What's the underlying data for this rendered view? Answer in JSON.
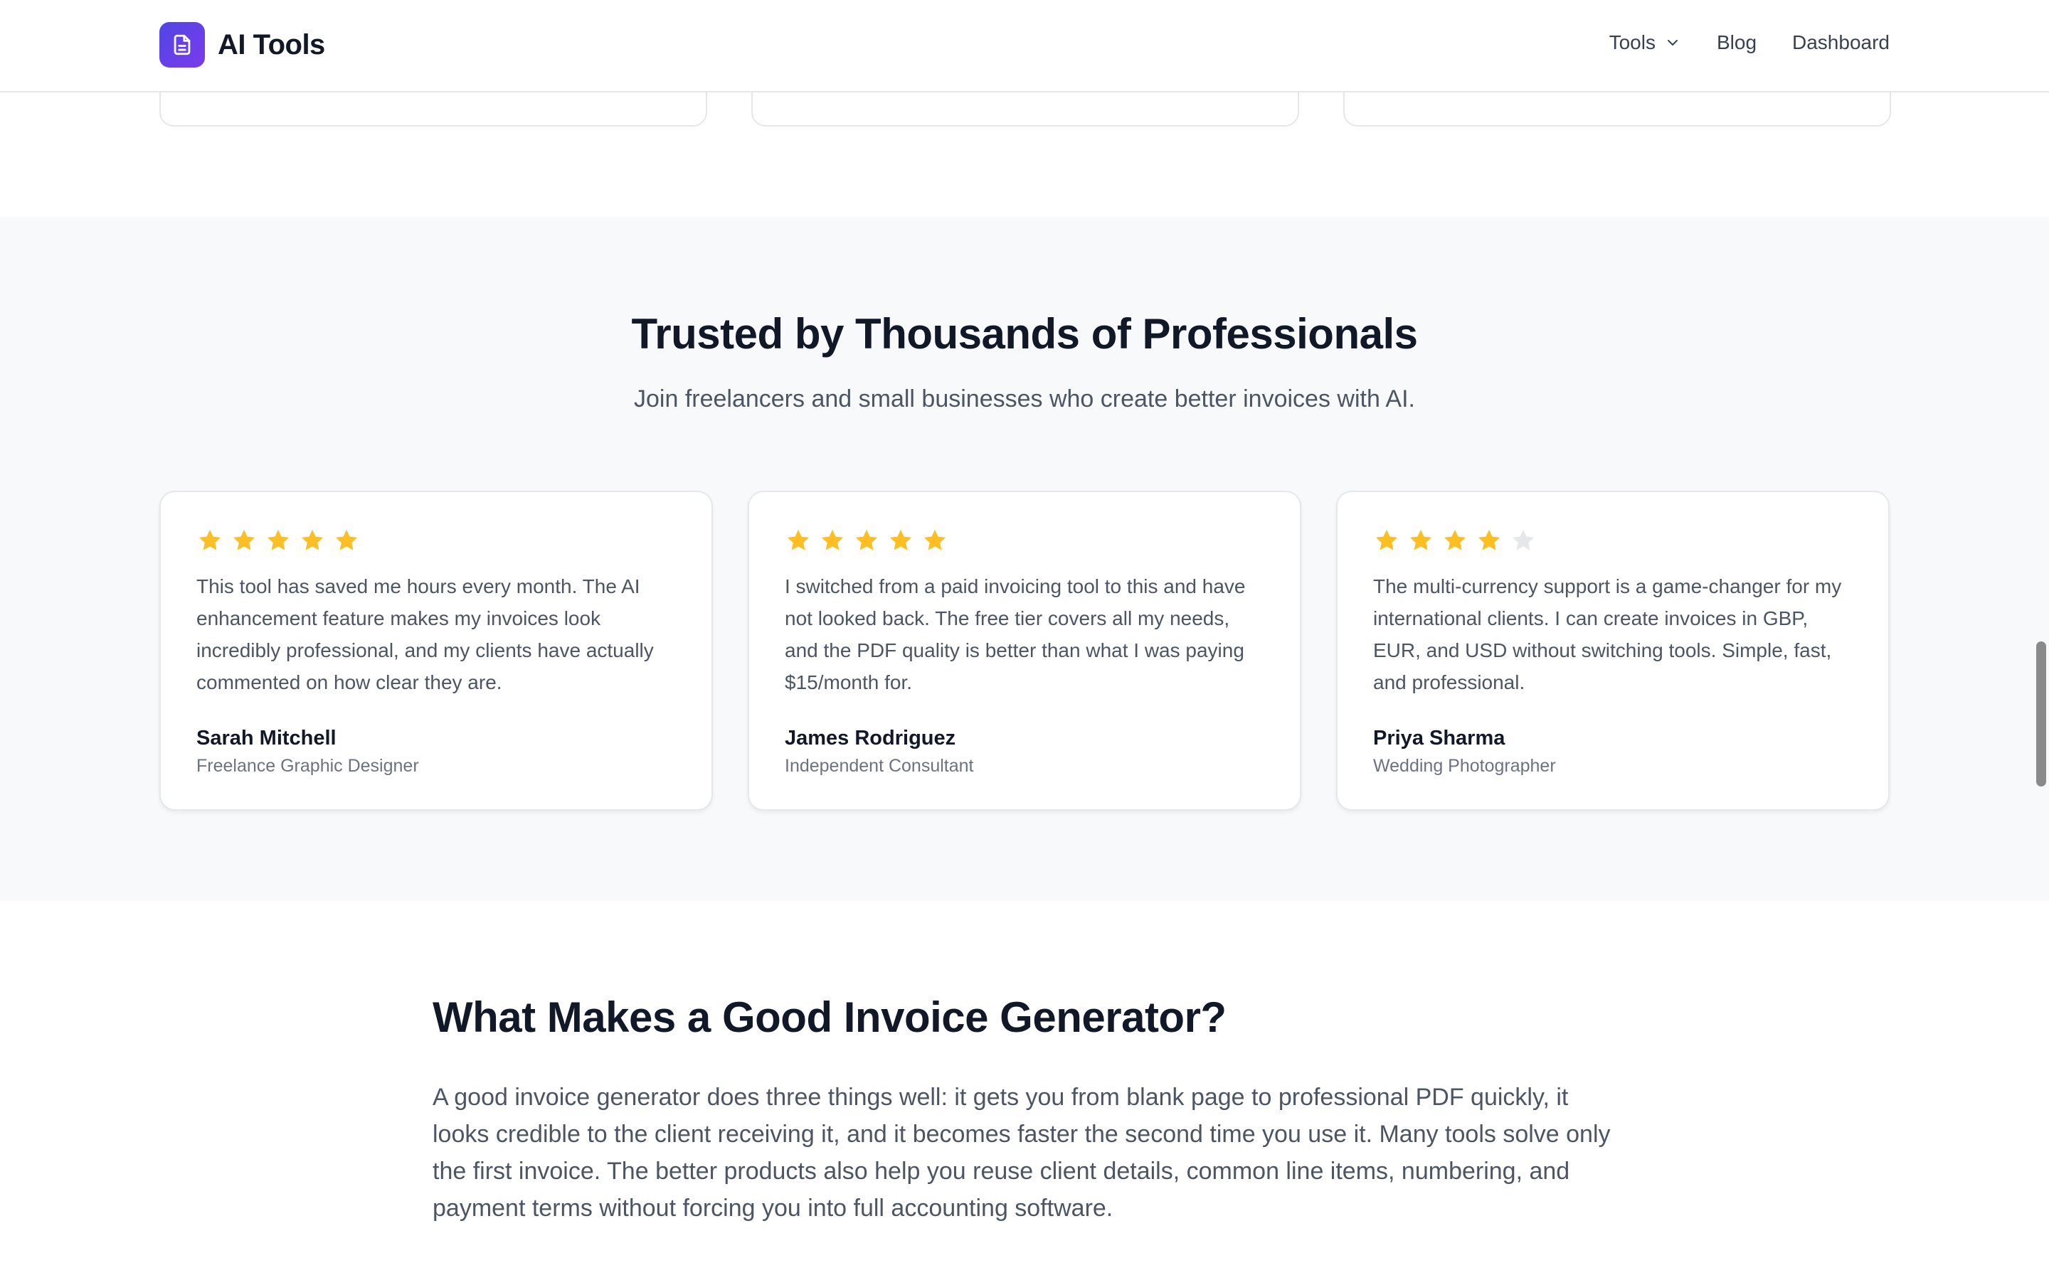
{
  "header": {
    "brand_name": "AI Tools",
    "nav": [
      {
        "label": "Tools"
      },
      {
        "label": "Blog"
      },
      {
        "label": "Dashboard"
      }
    ]
  },
  "testimonials": {
    "title": "Trusted by Thousands of Professionals",
    "subtitle": "Join freelancers and small businesses who create better invoices with AI.",
    "star_color": "#fbbf24",
    "star_empty_color": "#e5e7eb",
    "cards": [
      {
        "rating": 5,
        "quote": "This tool has saved me hours every month. The AI enhancement feature makes my invoices look incredibly professional, and my clients have actually commented on how clear they are.",
        "name": "Sarah Mitchell",
        "role": "Freelance Graphic Designer"
      },
      {
        "rating": 5,
        "quote": "I switched from a paid invoicing tool to this and have not looked back. The free tier covers all my needs, and the PDF quality is better than what I was paying $15/month for.",
        "name": "James Rodriguez",
        "role": "Independent Consultant"
      },
      {
        "rating": 4,
        "quote": "The multi-currency support is a game-changer for my international clients. I can create invoices in GBP, EUR, and USD without switching tools. Simple, fast, and professional.",
        "name": "Priya Sharma",
        "role": "Wedding Photographer"
      }
    ]
  },
  "article": {
    "title": "What Makes a Good Invoice Generator?",
    "body": "A good invoice generator does three things well: it gets you from blank page to professional PDF quickly, it looks credible to the client receiving it, and it becomes faster the second time you use it. Many tools solve only the first invoice. The better products also help you reuse client details, common line items, numbering, and payment terms without forcing you into full accounting software."
  }
}
